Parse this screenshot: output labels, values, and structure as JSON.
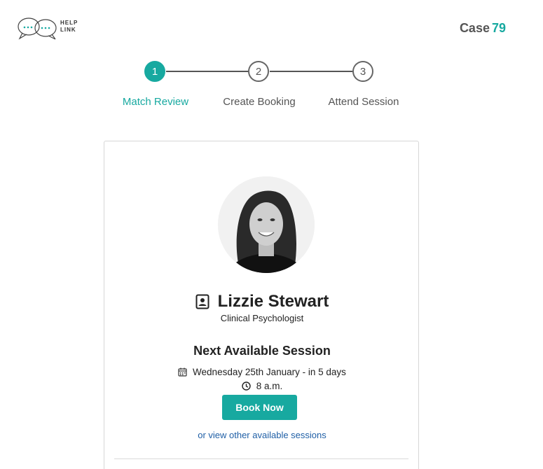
{
  "header": {
    "logo_text_line1": "HELP",
    "logo_text_line2": "LINK",
    "case_label": "Case",
    "case_number": "79"
  },
  "stepper": {
    "steps": [
      {
        "number": "1",
        "label": "Match Review",
        "active": true
      },
      {
        "number": "2",
        "label": "Create Booking",
        "active": false
      },
      {
        "number": "3",
        "label": "Attend Session",
        "active": false
      }
    ]
  },
  "profile": {
    "name": "Lizzie Stewart",
    "role": "Clinical Psychologist",
    "name_icon": "contact-card-icon"
  },
  "session": {
    "title": "Next Available Session",
    "date": "Wednesday 25th January - in 5 days",
    "time": "8 a.m.",
    "date_icon": "calendar-icon",
    "time_icon": "clock-icon",
    "book_label": "Book Now",
    "other_link": "or view other available sessions"
  },
  "colors": {
    "accent": "#17a9a0",
    "link": "#1f5fa6"
  }
}
